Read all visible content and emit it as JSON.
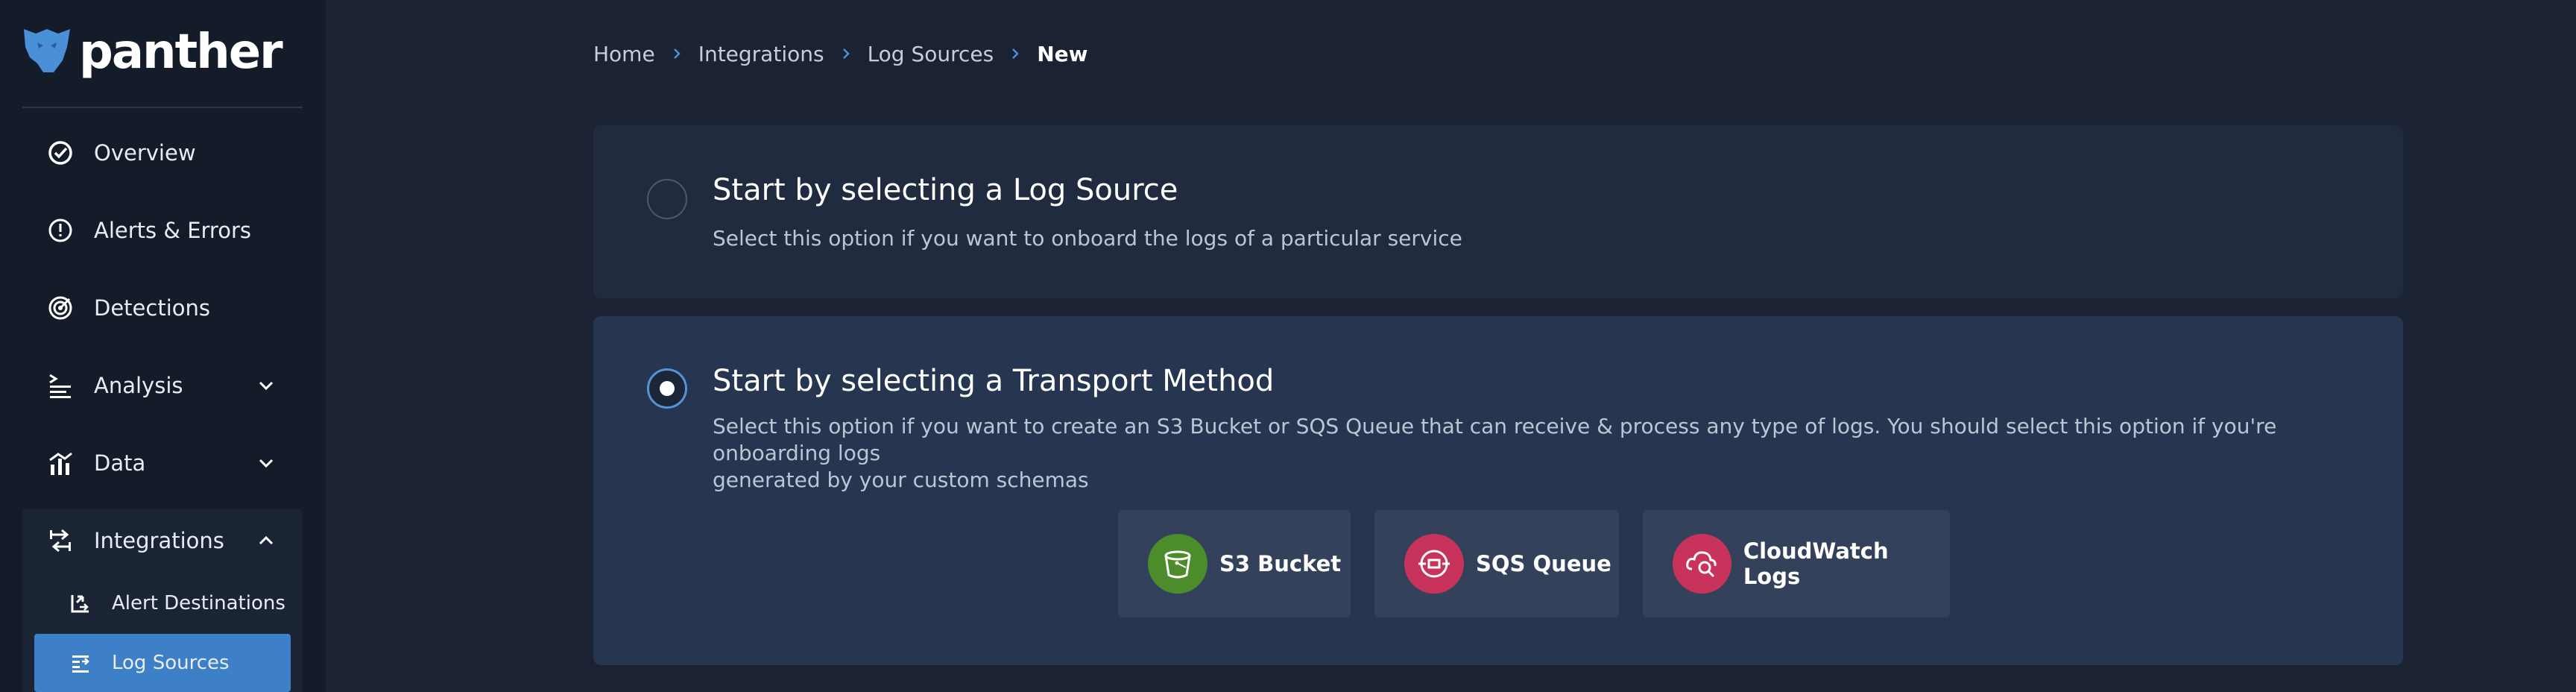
{
  "brand": {
    "name": "panther",
    "logo_icon": "panther-logo-icon"
  },
  "sidebar": {
    "items": [
      {
        "label": "Overview",
        "icon": "overview-icon"
      },
      {
        "label": "Alerts & Errors",
        "icon": "alert-icon"
      },
      {
        "label": "Detections",
        "icon": "detections-icon"
      },
      {
        "label": "Analysis",
        "icon": "analysis-icon",
        "expandable": true
      },
      {
        "label": "Data",
        "icon": "data-icon",
        "expandable": true
      },
      {
        "label": "Integrations",
        "icon": "integrations-icon",
        "expandable": true,
        "expanded": true
      }
    ],
    "sub_items": [
      {
        "label": "Alert Destinations",
        "icon": "alert-destinations-icon"
      },
      {
        "label": "Log Sources",
        "icon": "log-sources-icon",
        "active": true
      }
    ]
  },
  "breadcrumb": {
    "items": [
      "Home",
      "Integrations",
      "Log Sources"
    ],
    "current": "New"
  },
  "options": [
    {
      "title": "Start by selecting a Log Source",
      "description": "Select this option if you want to onboard the logs of a particular service",
      "selected": false
    },
    {
      "title": "Start by selecting a Transport Method",
      "description": "Select this option if you want to create an S3 Bucket or SQS Queue that can receive & process any type of logs. You should select this option if you're onboarding logs",
      "description_line2": "generated by your custom schemas",
      "selected": true
    }
  ],
  "transports": [
    {
      "label": "S3 Bucket",
      "icon": "s3-bucket-icon",
      "color": "#4d8c2b"
    },
    {
      "label": "SQS Queue",
      "icon": "sqs-queue-icon",
      "color": "#c7335a"
    },
    {
      "label": "CloudWatch Logs",
      "icon": "cloudwatch-icon",
      "color": "#c7335a"
    }
  ],
  "colors": {
    "background": "#1a2233",
    "sidebar": "#141b29",
    "accent": "#3d80c7",
    "card": "#202b3f",
    "card_selected": "#263650"
  }
}
